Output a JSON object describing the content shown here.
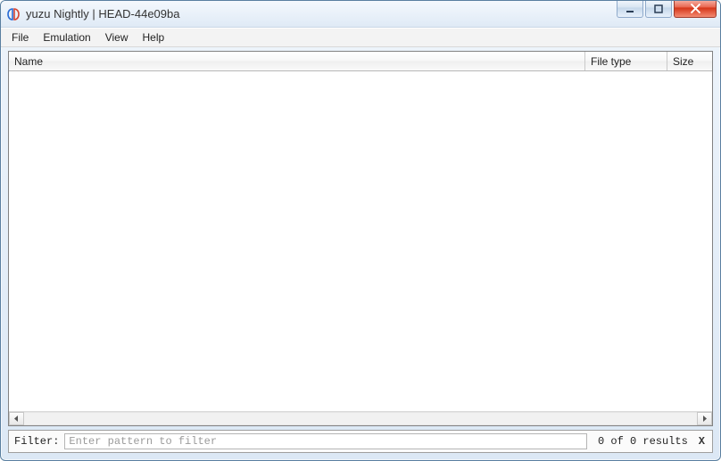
{
  "window": {
    "title": "yuzu Nightly | HEAD-44e09ba"
  },
  "menu": {
    "file": "File",
    "emulation": "Emulation",
    "view": "View",
    "help": "Help"
  },
  "columns": {
    "name": "Name",
    "file_type": "File type",
    "size": "Size"
  },
  "filter": {
    "label": "Filter:",
    "placeholder": "Enter pattern to filter",
    "value": "",
    "results_text": "0 of 0 results",
    "clear_label": "X"
  }
}
